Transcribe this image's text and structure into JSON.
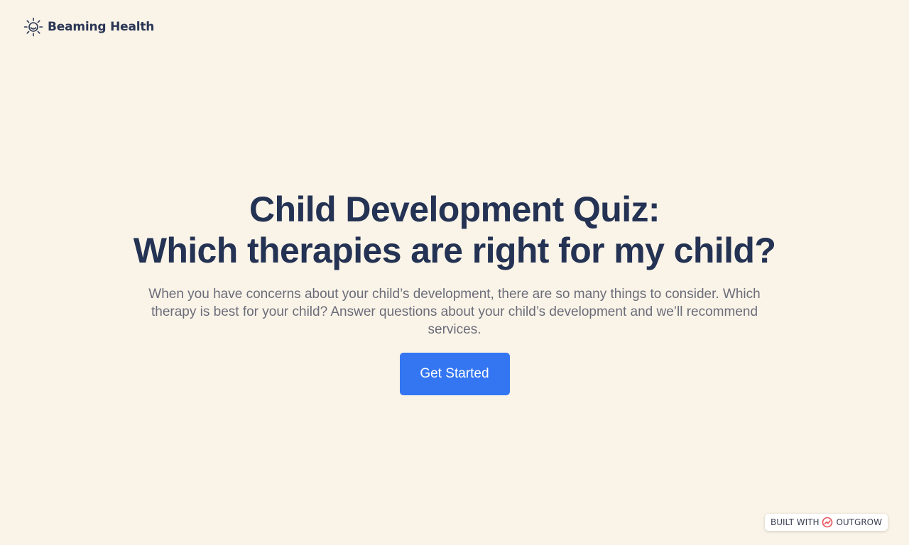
{
  "brand": {
    "name": "Beaming Health",
    "logo_icon": "sun-icon"
  },
  "hero": {
    "title_line1": "Child Development Quiz:",
    "title_line2": "Which therapies are right for my child?",
    "description": "When you have concerns about your child’s development, there are so many things to consider. Which therapy is best for your child? Answer questions about your child’s development and we’ll recommend services.",
    "cta_label": "Get Started"
  },
  "footer_badge": {
    "prefix": "BUILT WITH",
    "brand": "OUTGROW",
    "icon": "outgrow-logo-icon"
  },
  "colors": {
    "background": "#faf4e8",
    "heading": "#243253",
    "body_text": "#6b6c7a",
    "accent": "#3476f2"
  }
}
